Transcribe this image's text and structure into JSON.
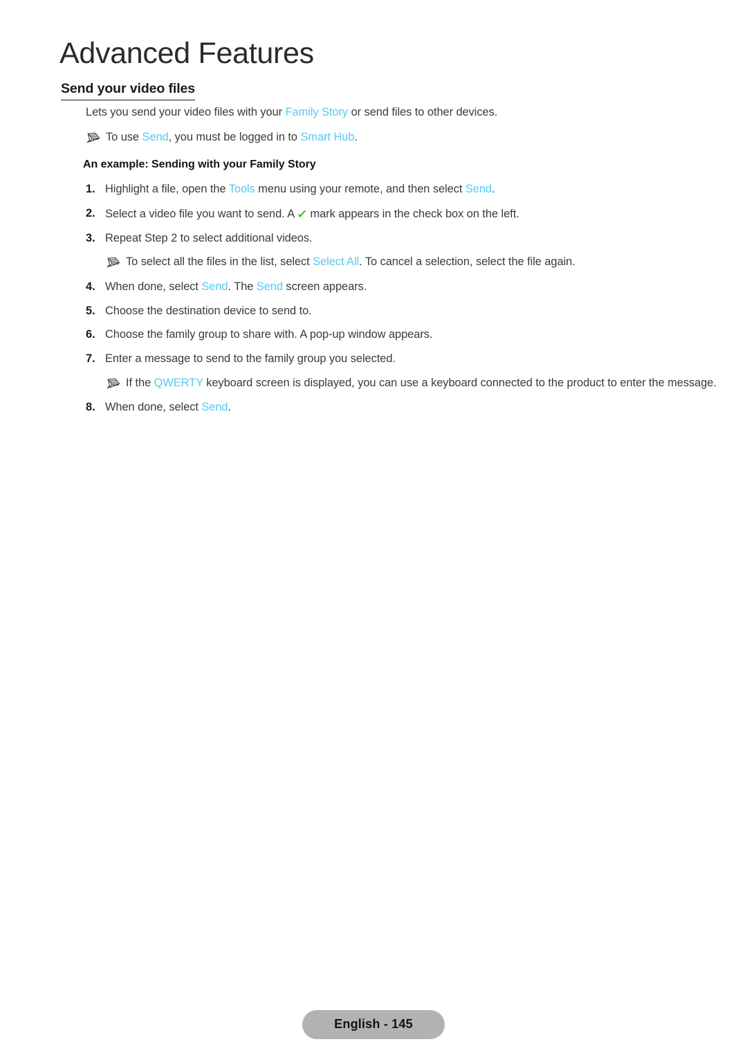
{
  "chapter": {
    "title": "Advanced Features"
  },
  "section": {
    "heading": "Send your video files"
  },
  "intro": {
    "text_before": "Lets you send your video files with your ",
    "link": "Family Story",
    "text_after": " or send files to other devices."
  },
  "note_intro": {
    "icon": "pencil-note-icon",
    "text_1": "To use ",
    "link_1": "Send",
    "text_2": ", you must be logged in to ",
    "link_2": "Smart Hub",
    "text_3": "."
  },
  "example": {
    "heading": "An example: Sending with your Family Story"
  },
  "steps": [
    {
      "num": "1.",
      "text_1": "Highlight a file, open the ",
      "link_1": "Tools",
      "text_2": " menu using your remote, and then select ",
      "link_2": "Send",
      "text_3": "."
    },
    {
      "num": "2.",
      "text_1": "Select a video file you want to send. A ",
      "check": "✓",
      "text_2": " mark appears in the check box on the left."
    },
    {
      "num": "3.",
      "text_1": "Repeat Step 2 to select additional videos."
    },
    {
      "num": "4.",
      "text_1": "When done, select ",
      "link_1": "Send",
      "text_2": ". The ",
      "link_2": "Send",
      "text_3": " screen appears."
    },
    {
      "num": "5.",
      "text_1": "Choose the destination device to send to."
    },
    {
      "num": "6.",
      "text_1": "Choose the family group to share with. A pop-up window appears."
    },
    {
      "num": "7.",
      "text_1": "Enter a message to send to the family group you selected."
    },
    {
      "num": "8.",
      "text_1": "When done, select ",
      "link_1": "Send",
      "text_2": "."
    }
  ],
  "note_select_all": {
    "icon": "pencil-note-icon",
    "text_1": "To select all the files in the list, select ",
    "link_1": "Select All",
    "text_2": ". To cancel a selection, select the file again."
  },
  "note_qwerty": {
    "icon": "pencil-note-icon",
    "text_1": "If the ",
    "link_1": "QWERTY",
    "text_2": " keyboard screen is displayed, you can use a keyboard connected to the product to enter the message."
  },
  "footer": {
    "page_label": "English - 145"
  },
  "colors": {
    "ui_link": "#55c8f5",
    "check_green": "#3fd11f",
    "badge_bg": "#b2b2b2",
    "body_text": "#3a3a3a"
  }
}
